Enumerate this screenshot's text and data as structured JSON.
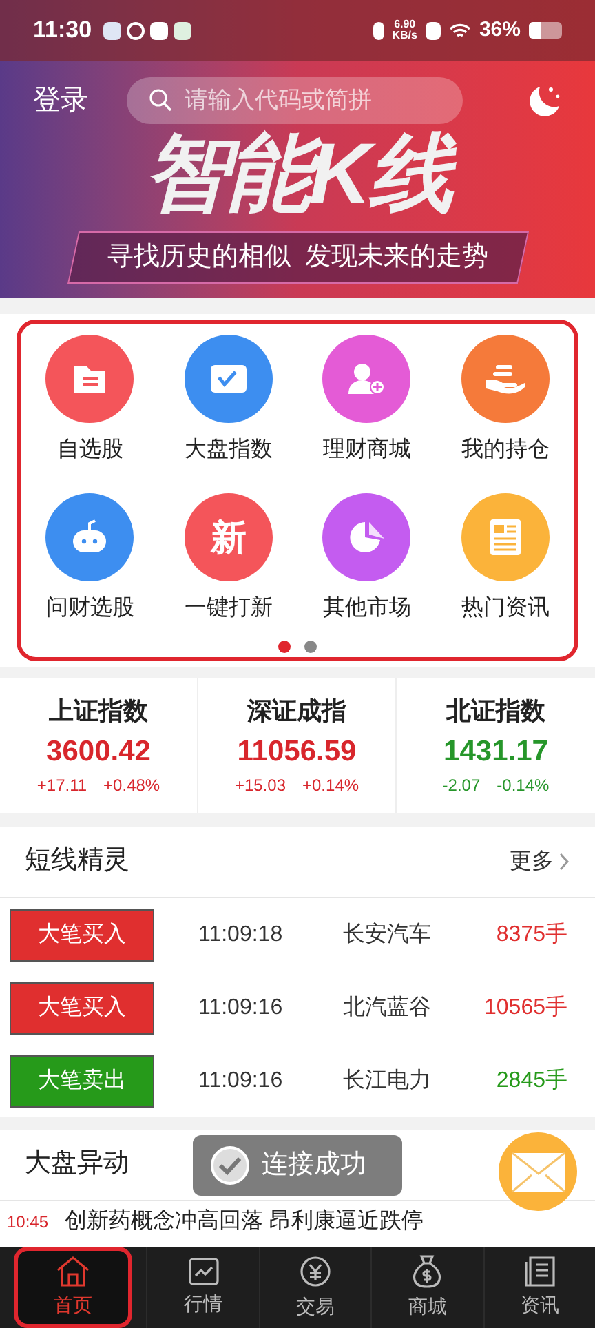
{
  "status_bar": {
    "time": "11:30",
    "net_speed": "6.90",
    "net_unit": "KB/s",
    "battery": "36%"
  },
  "header": {
    "login": "登录",
    "search": {
      "placeholder": "请输入代码或简拼"
    }
  },
  "banner": {
    "title": "智能K线",
    "subtitle": "寻找历史的相似  发现未来的走势"
  },
  "shortcuts": [
    {
      "label": "自选股",
      "kind": "folder",
      "color": "#f4555a"
    },
    {
      "label": "大盘指数",
      "kind": "chart",
      "color": "#3d8ef0"
    },
    {
      "label": "理财商城",
      "kind": "user",
      "color": "#e45bd6"
    },
    {
      "label": "我的持仓",
      "kind": "hand",
      "color": "#f57a3a"
    },
    {
      "label": "问财选股",
      "kind": "robot",
      "color": "#3d8ef0"
    },
    {
      "label": "一键打新",
      "kind": "text",
      "glyph": "新",
      "color": "#f4555a"
    },
    {
      "label": "其他市场",
      "kind": "pie",
      "color": "#c45cf0"
    },
    {
      "label": "热门资讯",
      "kind": "news",
      "color": "#fbb33a"
    }
  ],
  "pager": [
    {
      "selected": true
    },
    {
      "selected": false
    }
  ],
  "indices": [
    {
      "name": "上证指数",
      "value": "3600.42",
      "change": "+17.11",
      "percent": "+0.48%",
      "color": "#d8262c"
    },
    {
      "name": "深证成指",
      "value": "11056.59",
      "change": "+15.03",
      "percent": "+0.14%",
      "color": "#d8262c"
    },
    {
      "name": "北证指数",
      "value": "1431.17",
      "change": "-2.07",
      "percent": "-0.14%",
      "color": "#26962a"
    }
  ],
  "short_line": {
    "title": "短线精灵",
    "more": "更多",
    "rows": [
      {
        "tag": "大笔买入",
        "color": "#e02f2f",
        "time": "11:09:18",
        "stock": "长安汽车",
        "volume": "8375手"
      },
      {
        "tag": "大笔买入",
        "color": "#e02f2f",
        "time": "11:09:16",
        "stock": "北汽蓝谷",
        "volume": "10565手"
      },
      {
        "tag": "大笔卖出",
        "color": "#269a1a",
        "time": "11:09:16",
        "stock": "长江电力",
        "volume": "2845手"
      }
    ]
  },
  "market_moves": {
    "title": "大盘异动",
    "news": [
      {
        "time": "10:45",
        "text": "创新药概念冲高回落 昂利康逼近跌停"
      }
    ]
  },
  "toast": "连接成功",
  "tabs": [
    {
      "label": "首页",
      "kind": "home",
      "selected": true
    },
    {
      "label": "行情",
      "kind": "chart",
      "selected": false
    },
    {
      "label": "交易",
      "kind": "yen",
      "selected": false
    },
    {
      "label": "商城",
      "kind": "bag",
      "selected": false
    },
    {
      "label": "资讯",
      "kind": "doc",
      "selected": false
    }
  ]
}
